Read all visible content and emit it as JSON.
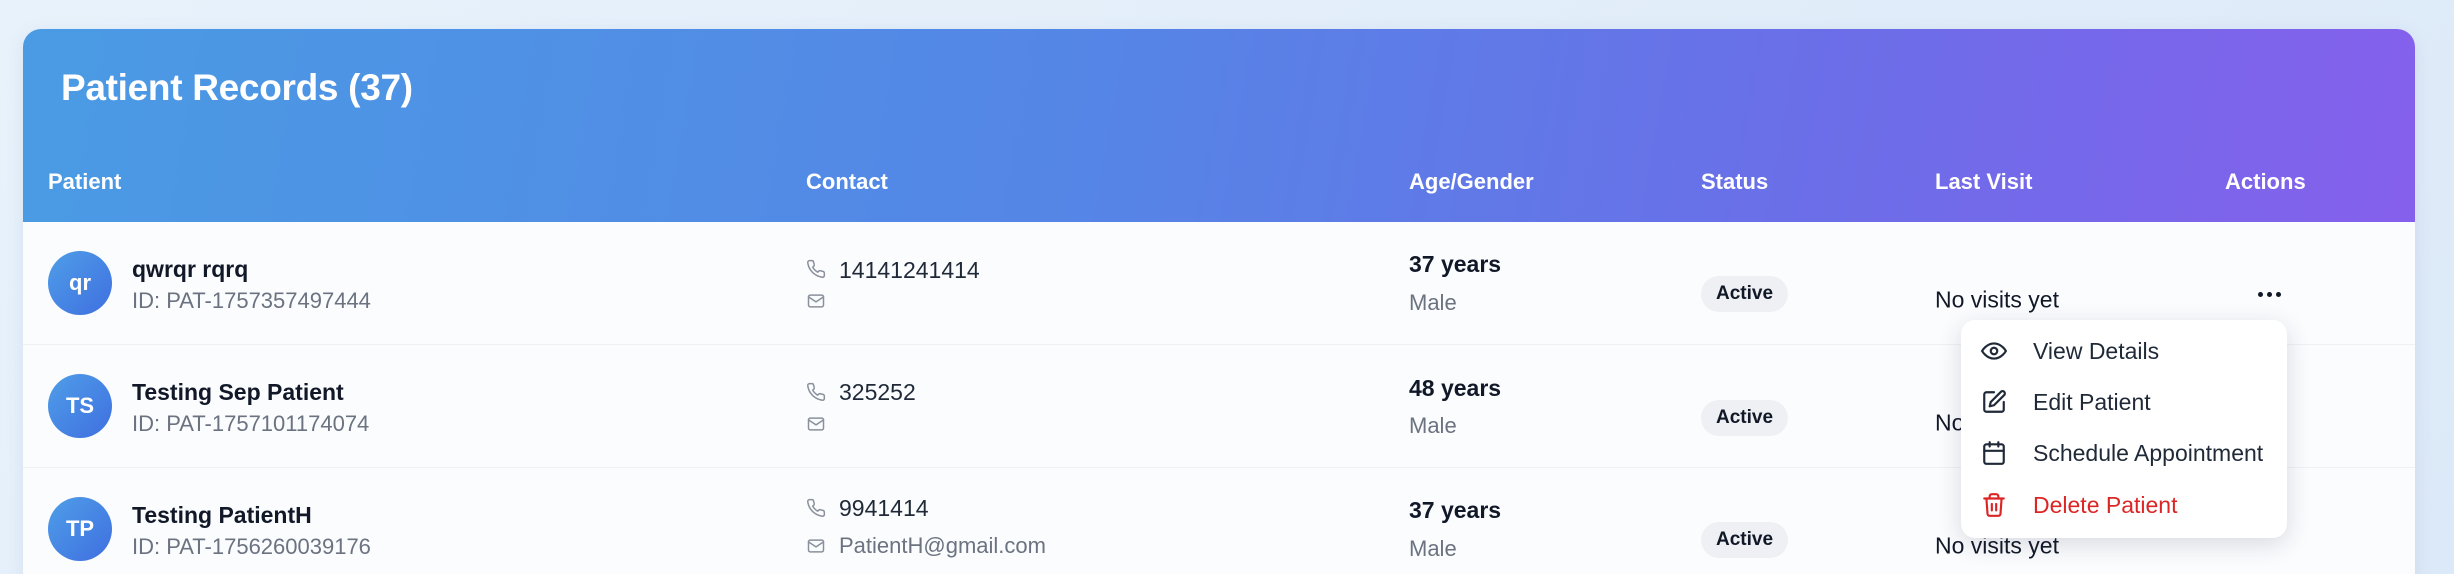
{
  "title": "Patient Records (37)",
  "columns": {
    "patient": "Patient",
    "contact": "Contact",
    "age_gender": "Age/Gender",
    "status": "Status",
    "last_visit": "Last Visit",
    "actions": "Actions"
  },
  "rows": [
    {
      "initials": "qr",
      "name": "qwrqr rqrq",
      "id": "ID: PAT-1757357497444",
      "phone": "14141241414",
      "email": "",
      "age": "37 years",
      "gender": "Male",
      "status": "Active",
      "last_visit": "No visits yet"
    },
    {
      "initials": "TS",
      "name": "Testing Sep Patient",
      "id": "ID: PAT-1757101174074",
      "phone": "325252",
      "email": "",
      "age": "48 years",
      "gender": "Male",
      "status": "Active",
      "last_visit": "No visits yet"
    },
    {
      "initials": "TP",
      "name": "Testing PatientH",
      "id": "ID: PAT-1756260039176",
      "phone": "9941414",
      "email": "PatientH@gmail.com",
      "age": "37 years",
      "gender": "Male",
      "status": "Active",
      "last_visit": "No visits yet"
    }
  ],
  "menu": {
    "items": [
      {
        "label": "View Details",
        "icon": "eye-icon"
      },
      {
        "label": "Edit Patient",
        "icon": "edit-icon"
      },
      {
        "label": "Schedule Appointment",
        "icon": "calendar-icon"
      },
      {
        "label": "Delete Patient",
        "icon": "trash-icon"
      }
    ]
  },
  "colors": {
    "header_gradient_start": "#4a9be4",
    "header_gradient_end": "#8560ec",
    "avatar": "#4a88e6",
    "danger": "#dc2626"
  }
}
